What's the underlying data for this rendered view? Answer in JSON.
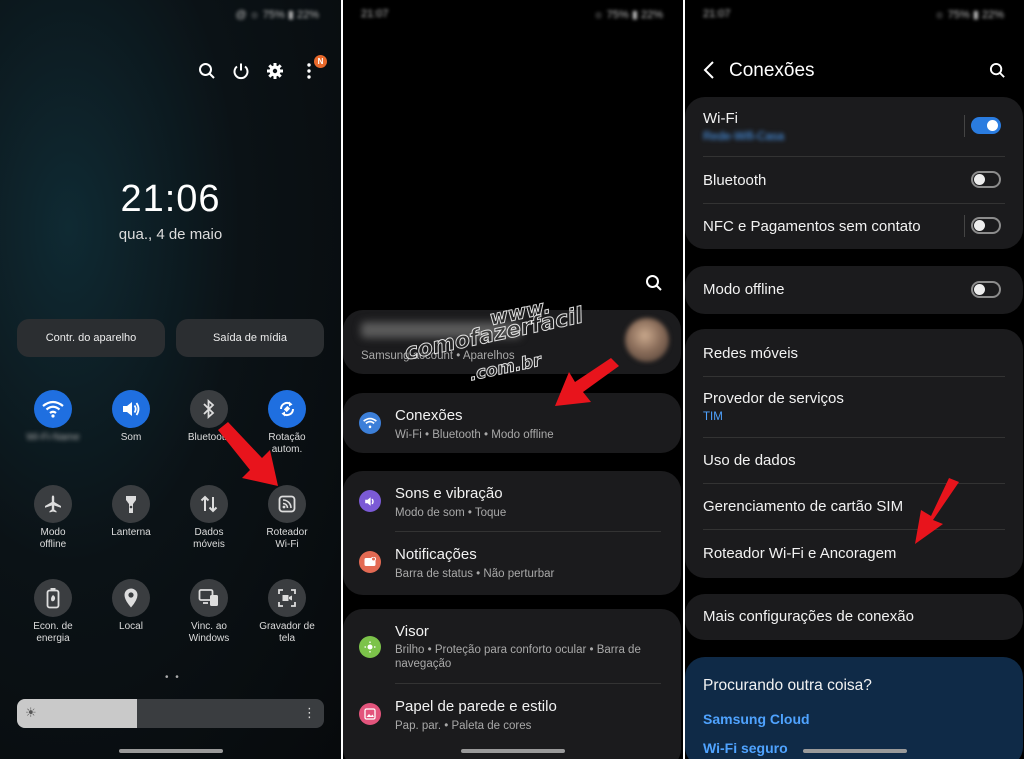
{
  "panel1": {
    "status_text": "@ ☼ 75% ▮ 22%",
    "badge": "N",
    "clock": "21:06",
    "date": "qua., 4 de maio",
    "buttons": {
      "device_control": "Contr. do aparelho",
      "media_output": "Saída de mídia"
    },
    "tiles": [
      {
        "label": "Wi-Fi-Name",
        "icon": "wifi-icon"
      },
      {
        "label": "Som",
        "icon": "sound-icon"
      },
      {
        "label": "Bluetooth",
        "icon": "bluetooth-icon"
      },
      {
        "label": "Rotação autom.",
        "icon": "rotate-icon"
      },
      {
        "label": "Modo offline",
        "icon": "airplane-icon"
      },
      {
        "label": "Lanterna",
        "icon": "flashlight-icon"
      },
      {
        "label": "Dados móveis",
        "icon": "data-icon"
      },
      {
        "label": "Roteador Wi-Fi",
        "icon": "hotspot-icon"
      },
      {
        "label": "Econ. de energia",
        "icon": "battery-icon"
      },
      {
        "label": "Local",
        "icon": "location-icon"
      },
      {
        "label": "Vinc. ao Windows",
        "icon": "link-windows-icon"
      },
      {
        "label": "Gravador de tela",
        "icon": "screen-recorder-icon"
      }
    ],
    "brightness_fraction": 0.39
  },
  "panel2": {
    "status_time": "21:07",
    "status_text": "☼ 75% ▮ 22%",
    "account": {
      "sub": "Samsung account • Aparelhos"
    },
    "items": {
      "connections": {
        "title": "Conexões",
        "sub": "Wi-Fi • Bluetooth • Modo offline"
      },
      "sounds": {
        "title": "Sons e vibração",
        "sub": "Modo de som • Toque"
      },
      "notifications": {
        "title": "Notificações",
        "sub": "Barra de status • Não perturbar"
      },
      "display": {
        "title": "Visor",
        "sub": "Brilho • Proteção para conforto ocular • Barra de navegação"
      },
      "wallpaper": {
        "title": "Papel de parede e estilo",
        "sub": "Pap. par. • Paleta de cores"
      }
    },
    "watermark": {
      "line1": "www.",
      "line2": "comofazerfacil",
      "line3": ".com.br"
    }
  },
  "panel3": {
    "status_time": "21:07",
    "status_text": "☼ 75% ▮ 22%",
    "title": "Conexões",
    "wifi": {
      "title": "Wi-Fi",
      "network": "Rede-Wifi-Casa",
      "on": true
    },
    "bluetooth": {
      "title": "Bluetooth",
      "on": false
    },
    "nfc": {
      "title": "NFC e Pagamentos sem contato",
      "on": false
    },
    "offline": {
      "title": "Modo offline",
      "on": false
    },
    "mobile_networks": "Redes móveis",
    "provider": {
      "title": "Provedor de serviços",
      "sub": "TIM"
    },
    "data_usage": "Uso de dados",
    "sim_manager": "Gerenciamento de cartão SIM",
    "hotspot": "Roteador Wi-Fi e Ancoragem",
    "more": "Mais configurações de conexão",
    "looking": {
      "title": "Procurando outra coisa?",
      "link1": "Samsung Cloud",
      "link2": "Wi-Fi seguro"
    }
  },
  "colors": {
    "accent": "#2a7ce0",
    "arrow": "#e8141c",
    "card": "#1b1b1d",
    "link": "#4fa3ff"
  }
}
